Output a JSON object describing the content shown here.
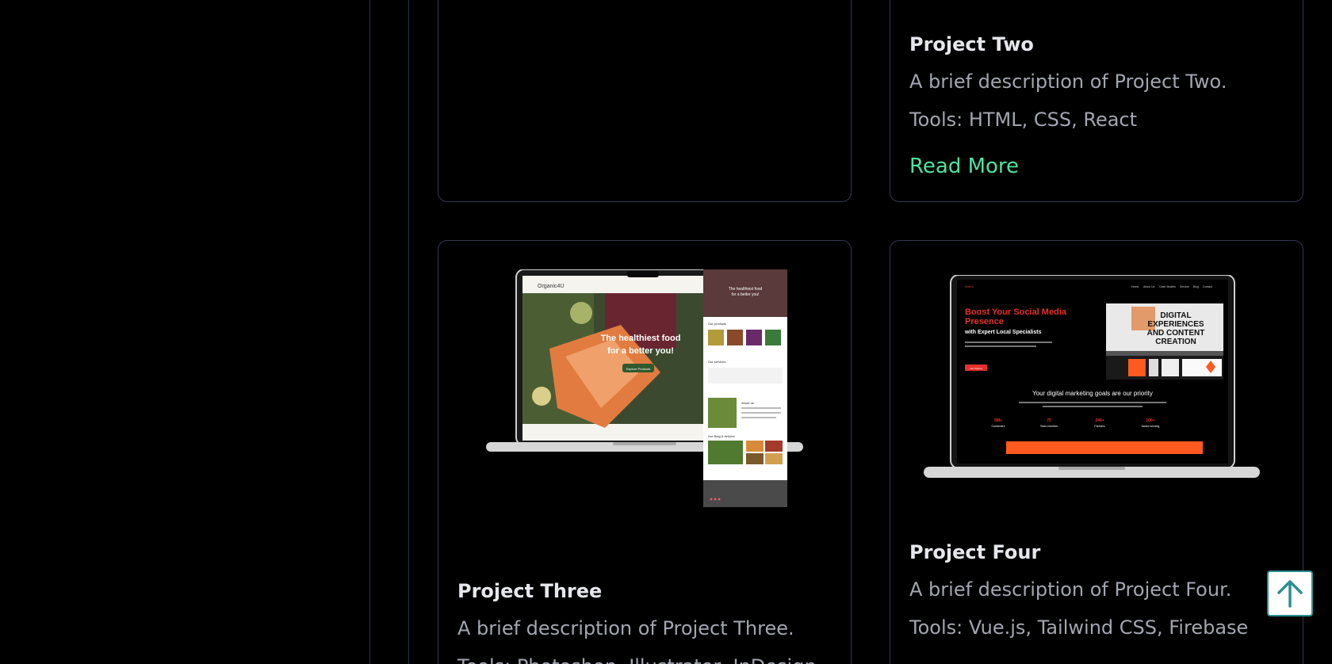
{
  "projects": [
    {
      "title": "Project Two",
      "description": "A brief description of Project Two.",
      "tools": "Tools: HTML, CSS, React",
      "link": "Read More"
    },
    {
      "title": "Project Three",
      "description": "A brief description of Project Three.",
      "tools": "Tools: Photoshop, Illustrator, InDesign",
      "screenshot": {
        "brand": "Organic4U",
        "hero": [
          "The healthiest food",
          "for a better you!"
        ],
        "button": "Explore Products",
        "side_hero": [
          "The healthiest food",
          "for a better you!"
        ],
        "sections": [
          "Our products",
          "Our services",
          "About us",
          "Our Blog & Articles"
        ]
      }
    },
    {
      "title": "Project Four",
      "description": "A brief description of Project Four.",
      "tools": "Tools: Vue.js, Tailwind CSS, Firebase",
      "screenshot": {
        "logo": "Brand",
        "nav": [
          "Home",
          "About Us",
          "Case Studies",
          "Service",
          "Blog",
          "Contact"
        ],
        "headline": [
          "Boost Your Social Media",
          "Presence"
        ],
        "subheadline": "with Expert Local Specialists",
        "cta": "Get Started",
        "hero_image_text": [
          "DIGITAL",
          "EXPERIENCES",
          "AND CONTENT",
          "CREATION"
        ],
        "section_title": "Your digital marketing goals are our priority",
        "stats": [
          {
            "value": "5M+",
            "label": "Customers"
          },
          {
            "value": "70",
            "label": "Team member"
          },
          {
            "value": "240+",
            "label": "Partners"
          },
          {
            "value": "100+",
            "label": "Award winning"
          }
        ]
      }
    }
  ],
  "colors": {
    "background": "#000000",
    "card_border": "#353852",
    "title": "#e6e7ec",
    "text": "#a3a6b0",
    "link": "#4ee3a0",
    "scroll_button_border": "#2d8f8f",
    "accent_red": "#e8302a",
    "accent_orange": "#ff5a1f"
  },
  "icons": {
    "scroll_top": "arrow-up-icon"
  }
}
